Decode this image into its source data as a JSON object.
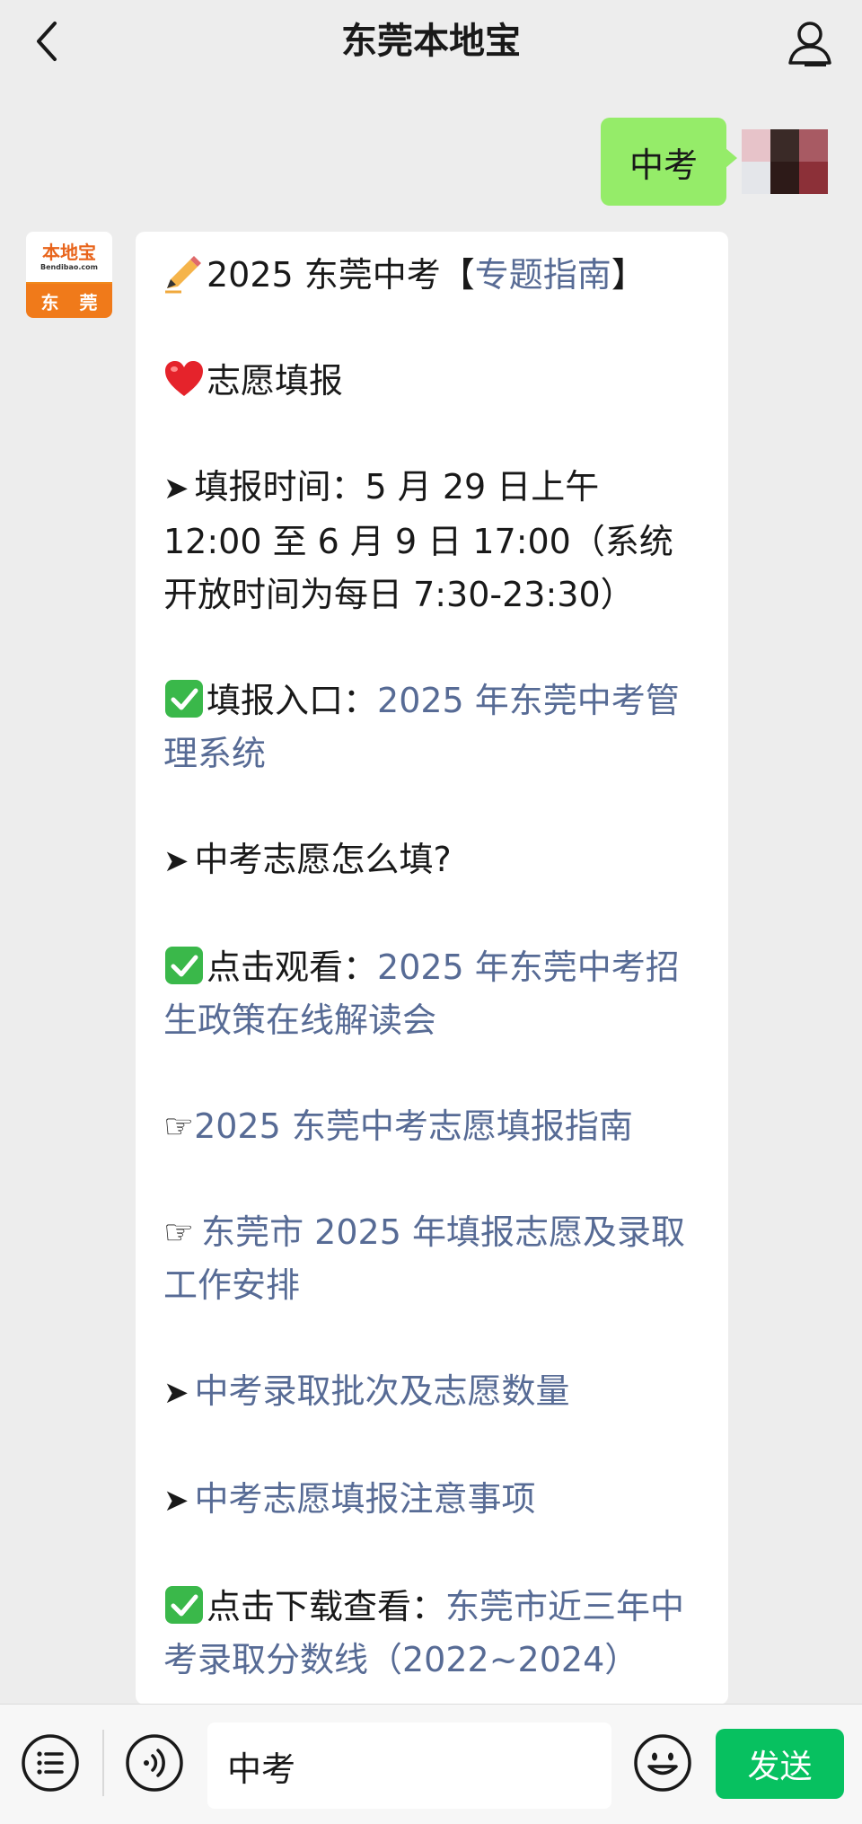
{
  "header": {
    "title": "东莞本地宝",
    "back_icon": "chevron-left-icon",
    "profile_icon": "person-icon"
  },
  "user_message": {
    "text": "中考"
  },
  "bot": {
    "avatar": {
      "logo_text": "本地宝",
      "logo_url": "Bendibao.com",
      "city": "东 莞"
    },
    "message": {
      "title_prefix": "2025 东莞中考【",
      "title_link": "专题指南",
      "title_suffix": "】",
      "section_heading": "志愿填报",
      "time_label": "填报时间：5 月 29 日上午 12:00 至 6 月 9 日 17:00（系统开放时间为每日 7:30-23:30）",
      "entry_label": "填报入口：",
      "entry_link": "2025 年东莞中考管理系统",
      "how_question": "中考志愿怎么填?",
      "watch_label": "点击观看：",
      "watch_link": "2025 年东莞中考招生政策在线解读会",
      "guide_link": "2025 东莞中考志愿填报指南",
      "arrangement_link": "东莞市 2025 年填报志愿及录取工作安排",
      "batch_link": "中考录取批次及志愿数量",
      "notice_link": "中考志愿填报注意事项",
      "download_label": "点击下载查看：",
      "download_link": "东莞市近三年中考录取分数线（2022~2024）"
    }
  },
  "input_bar": {
    "menu_icon": "list-menu-icon",
    "voice_icon": "voice-icon",
    "input_value": "中考",
    "emoji_icon": "smiley-icon",
    "send_label": "发送"
  },
  "colors": {
    "background": "#ededed",
    "user_bubble": "#95ec69",
    "link": "#576b95",
    "send_button": "#07c160"
  }
}
